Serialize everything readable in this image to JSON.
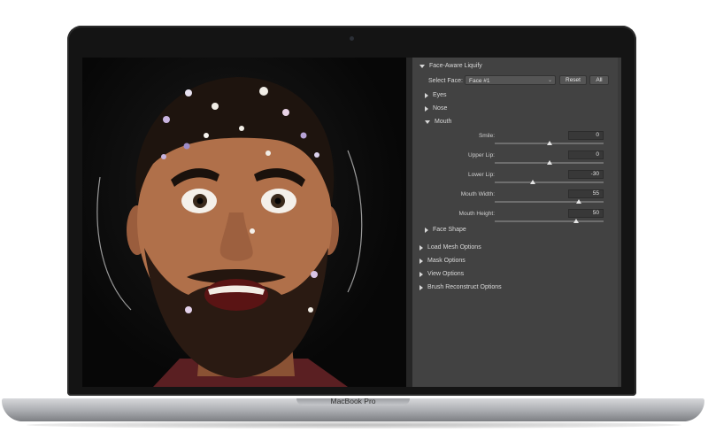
{
  "device": {
    "brand_label": "MacBook Pro"
  },
  "panel": {
    "section_title": "Face-Aware Liquify",
    "select_face_label": "Select Face:",
    "select_face_value": "Face #1",
    "reset_label": "Reset",
    "all_label": "All",
    "groups": {
      "eyes": "Eyes",
      "nose": "Nose",
      "mouth": "Mouth",
      "face_shape": "Face Shape"
    },
    "mouth_sliders": [
      {
        "label": "Smile:",
        "value": "0",
        "level": 0.5
      },
      {
        "label": "Upper Lip:",
        "value": "0",
        "level": 0.5
      },
      {
        "label": "Lower Lip:",
        "value": "-30",
        "level": 0.35
      },
      {
        "label": "Mouth Width:",
        "value": "55",
        "level": 0.775
      },
      {
        "label": "Mouth Height:",
        "value": "50",
        "level": 0.75
      }
    ],
    "options": {
      "load_mesh": "Load Mesh Options",
      "mask": "Mask Options",
      "view": "View Options",
      "brush_reconstruct": "Brush Reconstruct Options"
    }
  },
  "colors": {
    "panel_bg": "#424242",
    "canvas_bg": "#000000",
    "skin": "#b0704a",
    "beard": "#2a1a12"
  }
}
